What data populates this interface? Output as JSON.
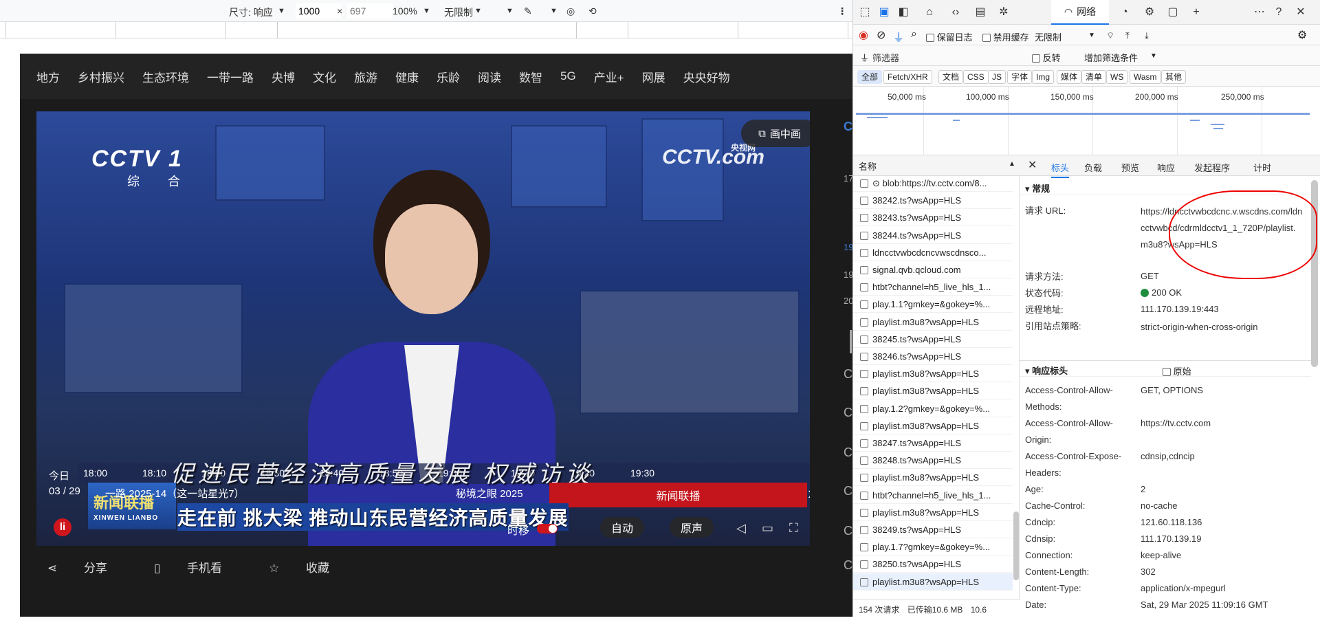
{
  "device_toolbar": {
    "size_label": "尺寸: 响应",
    "width": "1000",
    "times": "×",
    "height_placeholder": "697",
    "zoom": "100%",
    "throttle": "无限制"
  },
  "site": {
    "nav": [
      "地方",
      "乡村振兴",
      "生态环境",
      "一带一路",
      "央博",
      "文化",
      "旅游",
      "健康",
      "乐龄",
      "阅读",
      "数智",
      "5G",
      "产业+",
      "网展",
      "央央好物"
    ],
    "pip_label": "画中画",
    "channel_logo": "CCTV 1",
    "channel_sub": "综 合",
    "watermark": "CCTV.com",
    "watermark_sub": "央视网",
    "timeline_times": [
      "18:00",
      "18:10",
      "18:20",
      "18:30",
      "18:40",
      "18:50",
      "19:00",
      "19:10",
      "19:20",
      "19:30"
    ],
    "today_label": "今日",
    "date": "03 / 29",
    "episode": "一路 2025-14（这一站星光7）",
    "next_program": "秘境之眼 2025",
    "current_program": "新闻联播",
    "caption_top": "促进民营经济高质量发展 权威访谈",
    "caption_main": "走在前 挑大梁 推动山东民营经济高质量发展",
    "show_logo": "新闻联播",
    "show_logo_sub": "XINWEN LIANBO",
    "timeshift_label": "时移",
    "auto_label": "自动",
    "audio_label": "原声",
    "player_logo": "li",
    "share_label": "分享",
    "mobile_label": "手机看",
    "fav_label": "收藏",
    "right_labels": [
      "CC",
      "17",
      "19",
      "19",
      "20",
      "CC",
      "CC",
      "CC",
      "CC",
      "CC",
      "CC",
      "CC"
    ]
  },
  "devtools": {
    "active_tab": "网络",
    "preserve_log": "保留日志",
    "disable_cache": "禁用缓存",
    "throttle": "无限制",
    "filter_placeholder": "筛选器",
    "invert": "反转",
    "more_filters": "增加筛选条件",
    "type_filters": [
      "全部",
      "Fetch/XHR",
      "文档",
      "CSS",
      "JS",
      "字体",
      "Img",
      "媒体",
      "清单",
      "WS",
      "Wasm",
      "其他"
    ],
    "overview_ticks": [
      "50,000 ms",
      "100,000 ms",
      "150,000 ms",
      "200,000 ms",
      "250,000 ms"
    ],
    "name_header": "名称",
    "requests": [
      "⊙ blob:https://tv.cctv.com/8...",
      "38242.ts?wsApp=HLS",
      "38243.ts?wsApp=HLS",
      "38244.ts?wsApp=HLS",
      "ldncctvwbcdcncvwscdnsco...",
      "signal.qvb.qcloud.com",
      "htbt?channel=h5_live_hls_1...",
      "play.1.1?gmkey=&gokey=%...",
      "playlist.m3u8?wsApp=HLS",
      "38245.ts?wsApp=HLS",
      "38246.ts?wsApp=HLS",
      "playlist.m3u8?wsApp=HLS",
      "playlist.m3u8?wsApp=HLS",
      "play.1.2?gmkey=&gokey=%...",
      "playlist.m3u8?wsApp=HLS",
      "38247.ts?wsApp=HLS",
      "38248.ts?wsApp=HLS",
      "playlist.m3u8?wsApp=HLS",
      "htbt?channel=h5_live_hls_1...",
      "playlist.m3u8?wsApp=HLS",
      "38249.ts?wsApp=HLS",
      "play.1.7?gmkey=&gokey=%...",
      "38250.ts?wsApp=HLS",
      "playlist.m3u8?wsApp=HLS"
    ],
    "status_requests": "154 次请求",
    "status_transferred": "已传输10.6 MB",
    "status_extra": "10.6",
    "detail_tabs": [
      "标头",
      "负载",
      "预览",
      "响应",
      "发起程序",
      "计时"
    ],
    "general_title": "常规",
    "general": {
      "url_key": "请求 URL:",
      "url_val": "https://ldncctvwbcdcnc.v.wscdns.com/ldncctvwbcd/cdrmldcctv1_1_720P/playlist.m3u8?wsApp=HLS",
      "method_key": "请求方法:",
      "method_val": "GET",
      "status_key": "状态代码:",
      "status_val": "200 OK",
      "remote_key": "远程地址:",
      "remote_val": "111.170.139.19:443",
      "policy_key": "引用站点策略:",
      "policy_val": "strict-origin-when-cross-origin"
    },
    "resp_title": "响应标头",
    "raw_label": "原始",
    "resp_headers": [
      {
        "k": "Access-Control-Allow-Methods:",
        "v": "GET, OPTIONS"
      },
      {
        "k": "Access-Control-Allow-Origin:",
        "v": "https://tv.cctv.com"
      },
      {
        "k": "Access-Control-Expose-Headers:",
        "v": "cdnsip,cdncip"
      },
      {
        "k": "Age:",
        "v": "2"
      },
      {
        "k": "Cache-Control:",
        "v": "no-cache"
      },
      {
        "k": "Cdncip:",
        "v": "121.60.118.136"
      },
      {
        "k": "Cdnsip:",
        "v": "111.170.139.19"
      },
      {
        "k": "Connection:",
        "v": "keep-alive"
      },
      {
        "k": "Content-Length:",
        "v": "302"
      },
      {
        "k": "Content-Type:",
        "v": "application/x-mpegurl"
      },
      {
        "k": "Date:",
        "v": "Sat, 29 Mar 2025 11:09:16 GMT"
      }
    ]
  }
}
